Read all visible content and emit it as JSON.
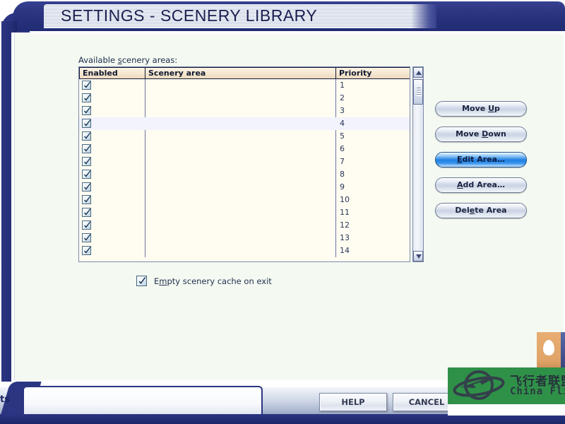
{
  "window": {
    "title": "SETTINGS - SCENERY LIBRARY"
  },
  "main": {
    "list_label_prefix": "Available ",
    "list_label_accel": "s",
    "list_label_suffix": "cenery areas:",
    "list_label_full": "Available scenery areas:",
    "columns": [
      {
        "key": "enabled",
        "label": "Enabled"
      },
      {
        "key": "scenery",
        "label": "Scenery area"
      },
      {
        "key": "priority",
        "label": "Priority"
      }
    ],
    "rows": [
      {
        "enabled": true,
        "scenery": "",
        "priority": "1",
        "selected": false
      },
      {
        "enabled": true,
        "scenery": "",
        "priority": "2",
        "selected": false
      },
      {
        "enabled": true,
        "scenery": "",
        "priority": "3",
        "selected": false
      },
      {
        "enabled": true,
        "scenery": "",
        "priority": "4",
        "selected": true
      },
      {
        "enabled": true,
        "scenery": "",
        "priority": "5",
        "selected": false
      },
      {
        "enabled": true,
        "scenery": "",
        "priority": "6",
        "selected": false
      },
      {
        "enabled": true,
        "scenery": "",
        "priority": "7",
        "selected": false
      },
      {
        "enabled": true,
        "scenery": "",
        "priority": "8",
        "selected": false
      },
      {
        "enabled": true,
        "scenery": "",
        "priority": "9",
        "selected": false
      },
      {
        "enabled": true,
        "scenery": "",
        "priority": "10",
        "selected": false
      },
      {
        "enabled": true,
        "scenery": "",
        "priority": "11",
        "selected": false
      },
      {
        "enabled": true,
        "scenery": "",
        "priority": "12",
        "selected": false
      },
      {
        "enabled": true,
        "scenery": "",
        "priority": "13",
        "selected": false
      },
      {
        "enabled": true,
        "scenery": "",
        "priority": "14",
        "selected": false
      }
    ],
    "scrollbar": {
      "up_arrow": "▲",
      "down_arrow": "▼",
      "thumb_position": "top"
    }
  },
  "side_buttons": [
    {
      "id": "move-up",
      "before": "Move ",
      "accel": "U",
      "after": "p",
      "focused": false
    },
    {
      "id": "move-down",
      "before": "Move ",
      "accel": "D",
      "after": "own",
      "focused": false
    },
    {
      "id": "edit-area",
      "before": "",
      "accel": "E",
      "after": "dit Area…",
      "focused": true
    },
    {
      "id": "add-area",
      "before": "",
      "accel": "A",
      "after": "dd Area…",
      "focused": false
    },
    {
      "id": "delete-area",
      "before": "Del",
      "accel": "e",
      "after": "te Area",
      "focused": false
    }
  ],
  "options": {
    "empty_cache": {
      "checked": true,
      "before": "E",
      "accel": "m",
      "after": "pty scenery cache on exit",
      "full": "Empty scenery cache on exit"
    }
  },
  "bottom_bar": {
    "tab_fragment": "ts",
    "buttons": [
      {
        "id": "help",
        "label": "HELP"
      },
      {
        "id": "cancel",
        "label": "CANCEL"
      }
    ]
  },
  "watermark": {
    "cn_text": "飞行者联盟",
    "en_text": "China Flier",
    "background": "#2f9148"
  },
  "tray": {
    "qq_icon": "qq-penguin-icon"
  },
  "colors": {
    "frame_navy": "#2b3582",
    "dialog_bg": "#f4faf2",
    "list_bg": "#fffdf2",
    "header_bg": "#f5e6cf",
    "selected_row": "#f2f3fd",
    "focus_blue": "#1f7fe0",
    "watermark_green": "#2f9148"
  }
}
